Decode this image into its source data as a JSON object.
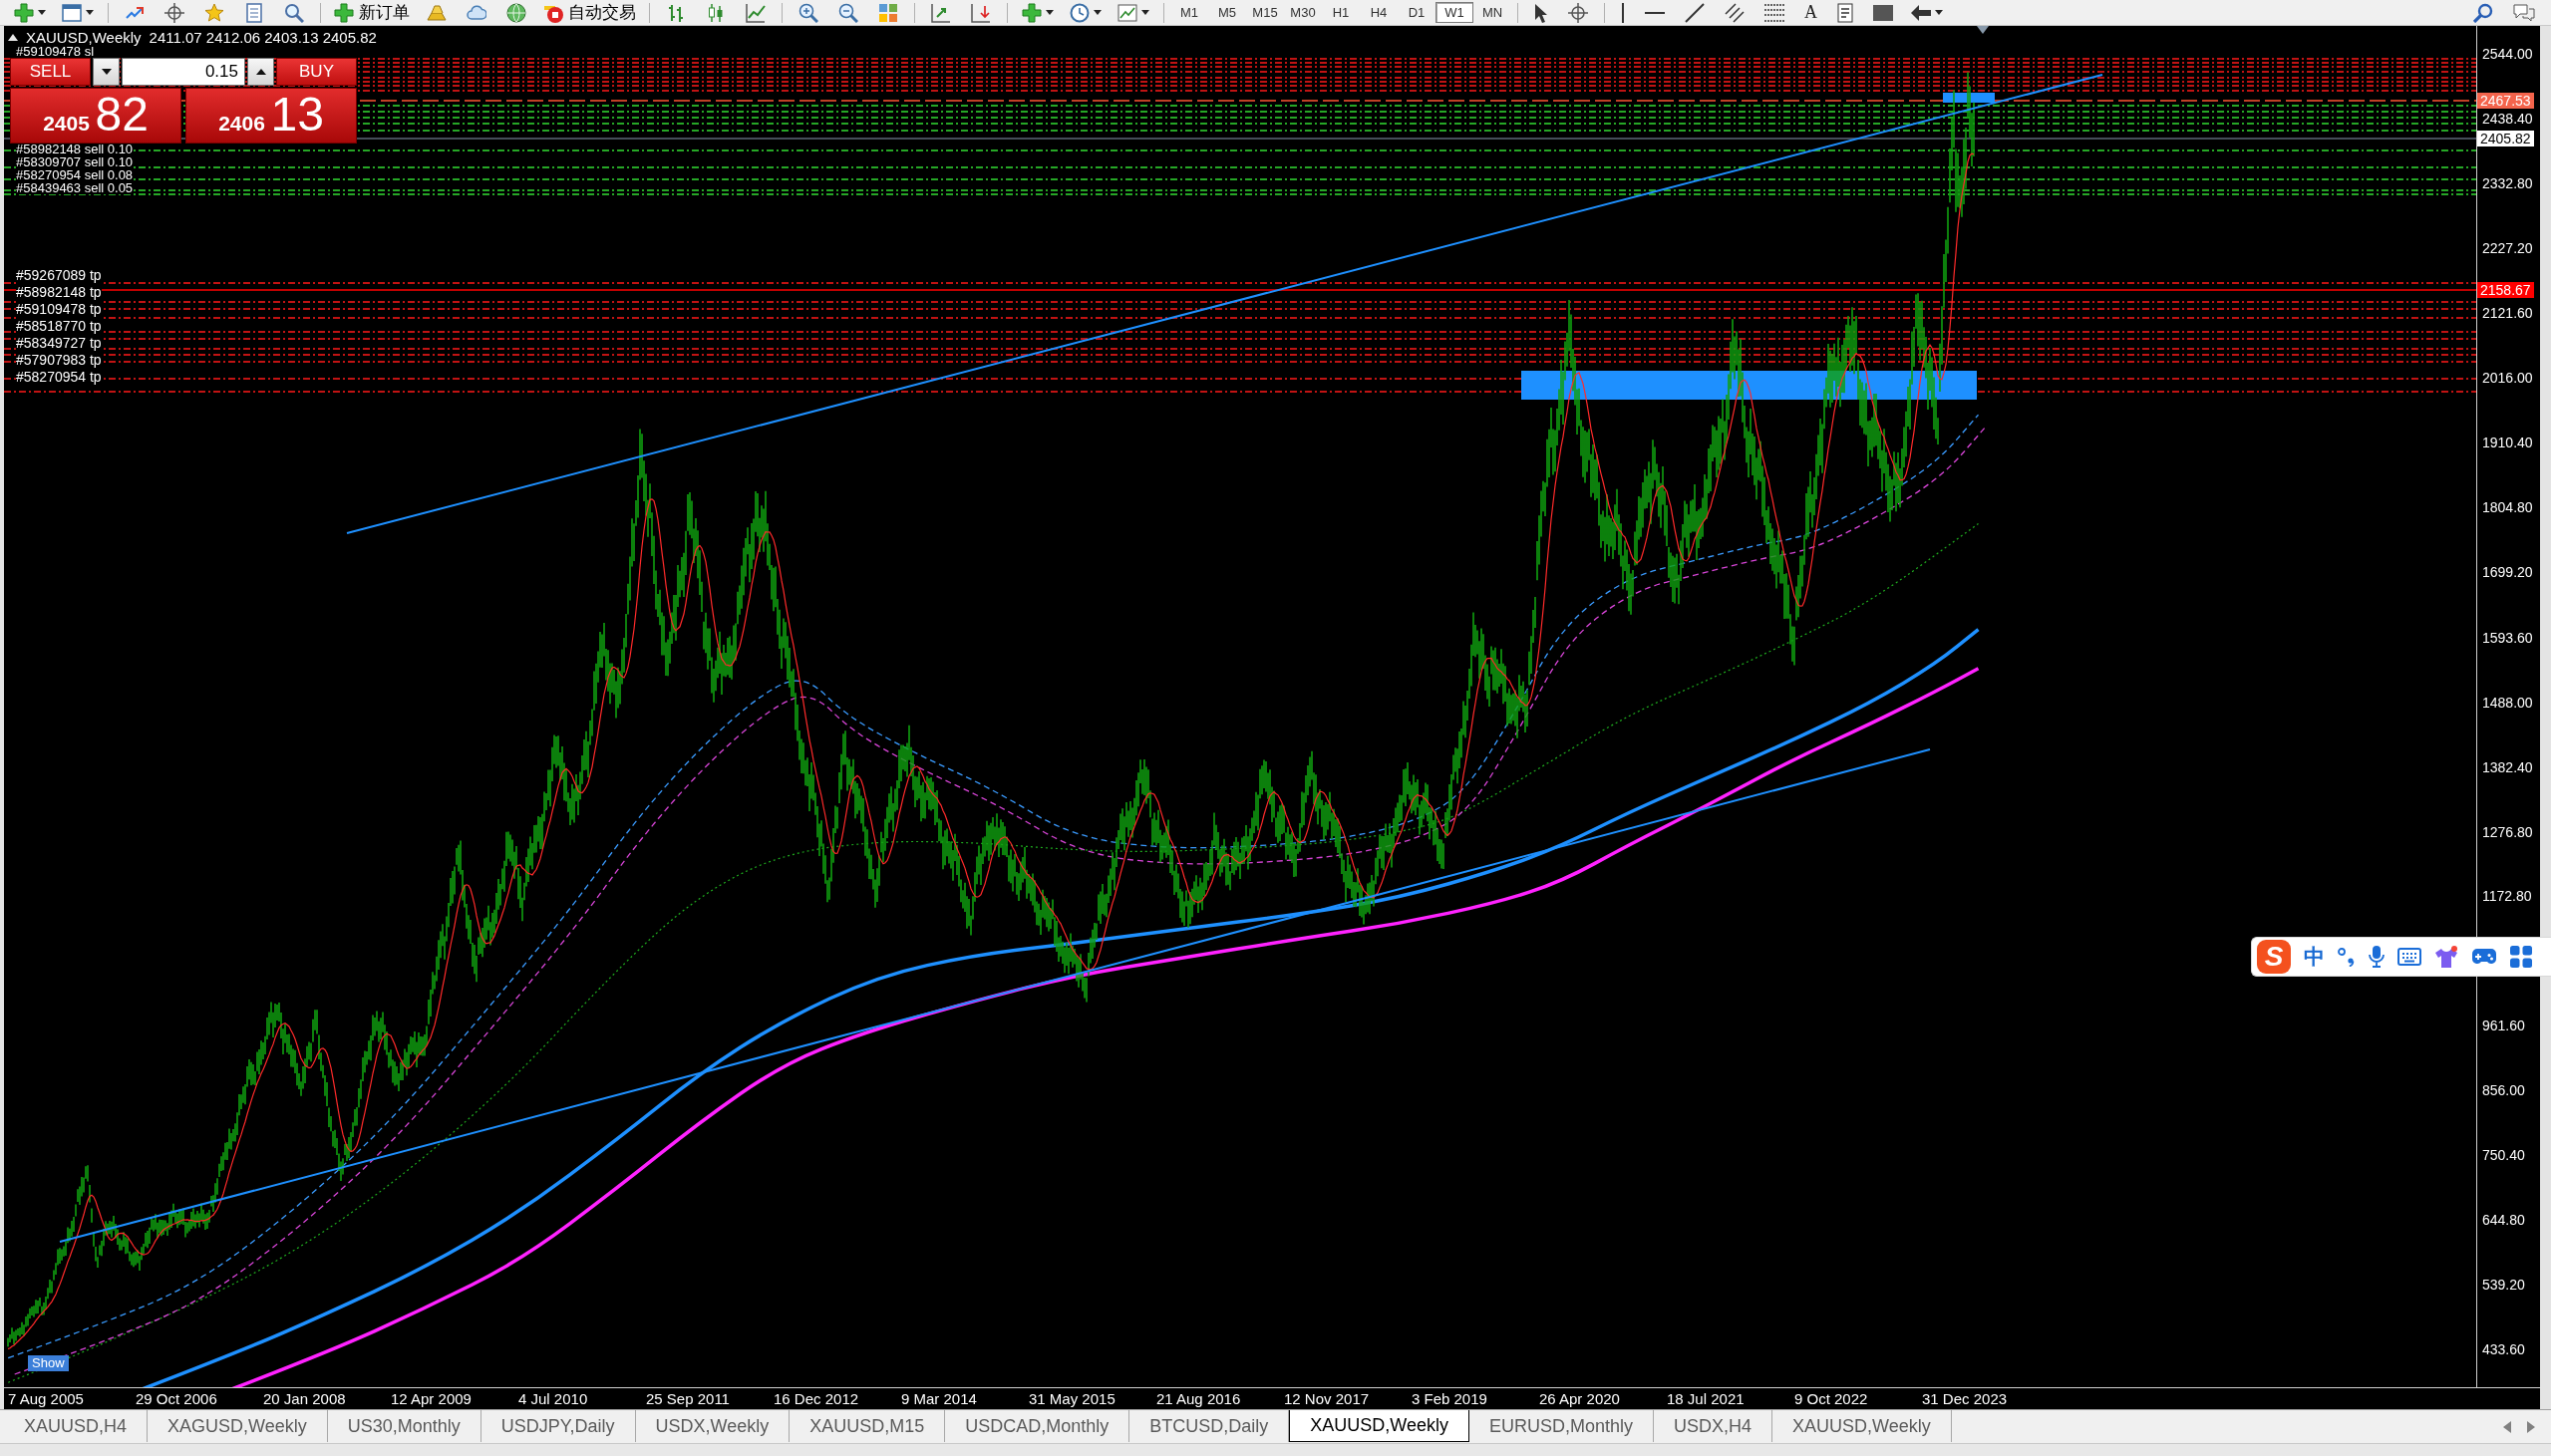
{
  "toolbar": {
    "new_order": "新订单",
    "auto_trading": "自动交易",
    "timeframes": [
      {
        "label": "M1",
        "selected": false
      },
      {
        "label": "M5",
        "selected": false
      },
      {
        "label": "M15",
        "selected": false
      },
      {
        "label": "M30",
        "selected": false
      },
      {
        "label": "H1",
        "selected": false
      },
      {
        "label": "H4",
        "selected": false
      },
      {
        "label": "D1",
        "selected": false
      },
      {
        "label": "W1",
        "selected": true
      },
      {
        "label": "MN",
        "selected": false
      }
    ],
    "text_tool": "A"
  },
  "chart": {
    "symbol": "XAUUSD,Weekly",
    "ohlc": "2411.07 2412.06 2403.13 2405.82",
    "show_button": "Show"
  },
  "trade_panel": {
    "sell": "SELL",
    "lot": "0.15",
    "buy": "BUY",
    "bid_big": "2405",
    "bid_pips": "82",
    "ask_big": "2406",
    "ask_pips": "13"
  },
  "order_labels": {
    "stop_loss": [
      "#59109478 sl"
    ],
    "sell": [
      "#58982148 sell 0.10",
      "#58309707 sell 0.10",
      "#58270954 sell 0.08",
      "#58439463 sell 0.05"
    ],
    "take_profit": [
      "#59267089 tp",
      "#58982148 tp",
      "#59109478 tp",
      "#58518770 tp",
      "#58349727 tp",
      "#57907983 tp",
      "#58270954 tp"
    ]
  },
  "price_axis": {
    "labels": [
      "2544.00",
      "2438.40",
      "2332.80",
      "2227.20",
      "2121.60",
      "2016.00",
      "1910.40",
      "1804.80",
      "1699.20",
      "1593.60",
      "1488.00",
      "1382.40",
      "1276.80",
      "1172.80",
      "961.60",
      "856.00",
      "750.40",
      "644.80",
      "539.20",
      "433.60"
    ],
    "markers": [
      {
        "text": "2467.53",
        "color": "#f4644c"
      },
      {
        "text": "2405.82",
        "color": "#ffffff"
      },
      {
        "text": "2158.67",
        "color": "#ff0000"
      }
    ]
  },
  "time_axis": {
    "labels": [
      "7 Aug 2005",
      "29 Oct 2006",
      "20 Jan 2008",
      "12 Apr 2009",
      "4 Jul 2010",
      "25 Sep 2011",
      "16 Dec 2012",
      "9 Mar 2014",
      "31 May 2015",
      "21 Aug 2016",
      "12 Nov 2017",
      "3 Feb 2019",
      "26 Apr 2020",
      "18 Jul 2021",
      "9 Oct 2022",
      "31 Dec 2023"
    ]
  },
  "tabs": [
    {
      "label": "XAUUSD,H4",
      "selected": false
    },
    {
      "label": "XAGUSD,Weekly",
      "selected": false
    },
    {
      "label": "US30,Monthly",
      "selected": false
    },
    {
      "label": "USDJPY,Daily",
      "selected": false
    },
    {
      "label": "USDX,Weekly",
      "selected": false
    },
    {
      "label": "XAUUSD,M15",
      "selected": false
    },
    {
      "label": "USDCAD,Monthly",
      "selected": false
    },
    {
      "label": "BTCUSD,Daily",
      "selected": false
    },
    {
      "label": "XAUUSD,Weekly",
      "selected": true
    },
    {
      "label": "EURUSD,Monthly",
      "selected": false
    },
    {
      "label": "USDX,H4",
      "selected": false
    },
    {
      "label": "XAUUSD,Weekly",
      "selected": false
    }
  ],
  "ime_toolbar": {
    "logo": "S",
    "mode": "中"
  }
}
